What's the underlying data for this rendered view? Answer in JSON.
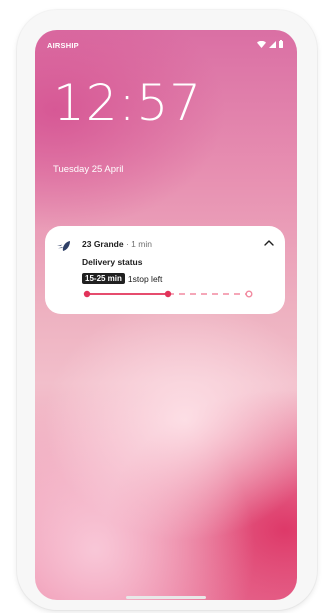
{
  "status_bar": {
    "carrier": "AIRSHIP",
    "icons": [
      "wifi-icon",
      "signal-icon",
      "battery-icon"
    ]
  },
  "lockscreen": {
    "time": "12:57",
    "date": "Tuesday 25 April"
  },
  "notification": {
    "app_name": "23 Grande",
    "separator": "·",
    "time": "1 min",
    "title": "Delivery status",
    "eta": "15-25 min",
    "stops": "1stop left",
    "progress": {
      "completed_fraction": 0.5
    },
    "icons": {
      "app": "delivery-app-icon",
      "expand": "chevron-up-icon"
    }
  },
  "colors": {
    "accent": "#e2335a",
    "badge_bg": "#202020",
    "wallpaper_top": "#da6fa4",
    "wallpaper_bottom": "#ea7ea0"
  }
}
